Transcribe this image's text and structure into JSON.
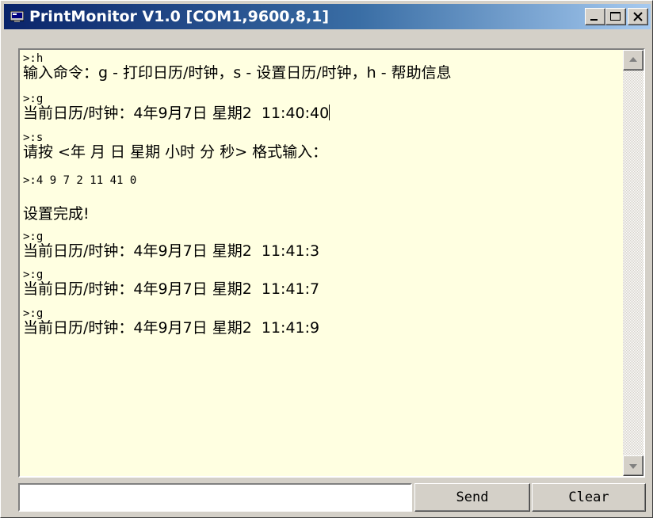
{
  "window": {
    "title": "PrintMonitor V1.0 [COM1,9600,8,1]",
    "icons": {
      "app": "monitor-icon",
      "minimize": "minimize-icon",
      "maximize": "maximize-icon",
      "close": "close-icon"
    }
  },
  "console": {
    "lines": [
      ">:h",
      "输入命令：g - 打印日历/时钟，s - 设置日历/时钟，h - 帮助信息",
      ">:g",
      "当前日历/时钟：4年9月7日 星期2  11:40:40",
      ">:s",
      "请按 <年 月 日 星期 小时 分 秒> 格式输入：",
      ">:4 9 7 2 11 41 0",
      "设置完成!",
      ">:g",
      "当前日历/时钟：4年9月7日 星期2  11:41:3",
      ">:g",
      "当前日历/时钟：4年9月7日 星期2  11:41:7",
      ">:g",
      "当前日历/时钟：4年9月7日 星期2  11:41:9"
    ]
  },
  "input": {
    "value": "",
    "placeholder": ""
  },
  "buttons": {
    "send": "Send",
    "clear": "Clear"
  },
  "colors": {
    "console_bg": "#ffffe1",
    "titlebar_start": "#0a246a",
    "titlebar_end": "#a6caf0",
    "window_face": "#d4d0c8"
  }
}
